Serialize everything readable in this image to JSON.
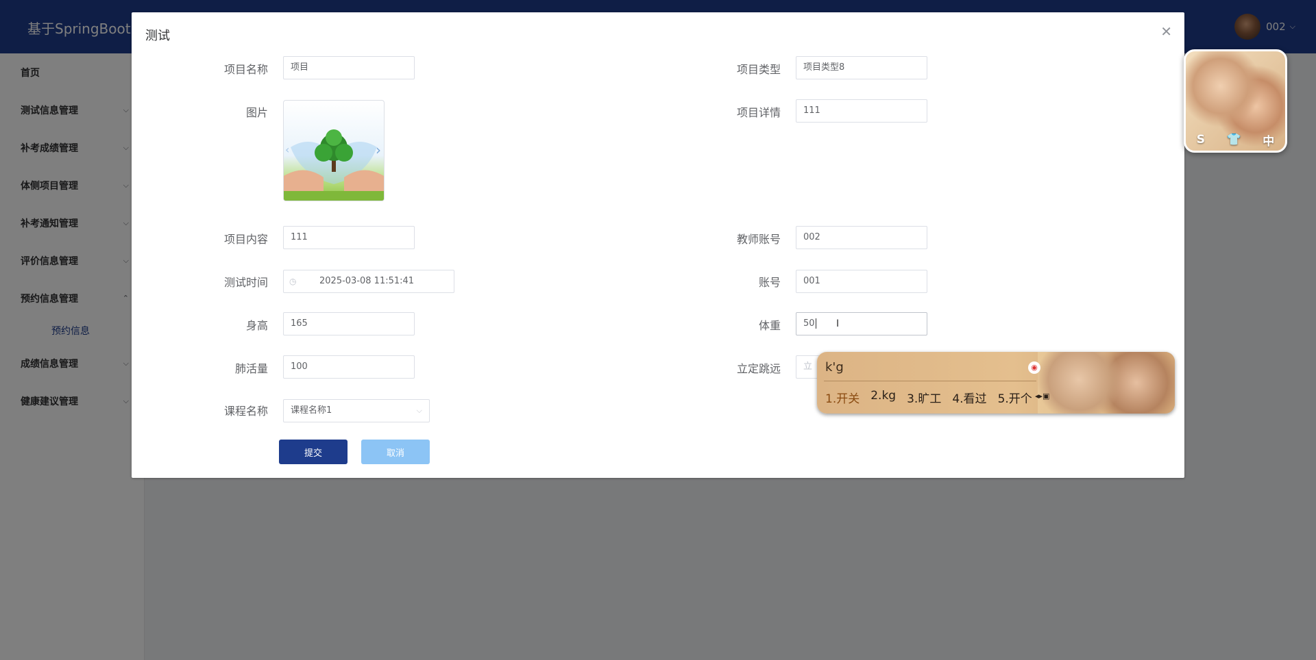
{
  "app": {
    "title": "基于SpringBoot",
    "user": "002"
  },
  "sidebar": {
    "items": [
      {
        "label": "首页"
      },
      {
        "label": "测试信息管理"
      },
      {
        "label": "补考成绩管理"
      },
      {
        "label": "体侧项目管理"
      },
      {
        "label": "补考通知管理"
      },
      {
        "label": "评价信息管理"
      },
      {
        "label": "预约信息管理"
      },
      {
        "label": "预约信息"
      },
      {
        "label": "成绩信息管理"
      },
      {
        "label": "健康建议管理"
      }
    ]
  },
  "dialog": {
    "title": "测试",
    "fields": {
      "project_name": {
        "label": "项目名称",
        "value": "项目"
      },
      "project_type": {
        "label": "项目类型",
        "value": "项目类型8"
      },
      "image": {
        "label": "图片"
      },
      "project_detail": {
        "label": "项目详情",
        "value": "111"
      },
      "project_content": {
        "label": "项目内容",
        "value": "111"
      },
      "teacher_account": {
        "label": "教师账号",
        "value": "002"
      },
      "test_time": {
        "label": "测试时间",
        "value": "2025-03-08 11:51:41"
      },
      "account": {
        "label": "账号",
        "value": "001"
      },
      "height": {
        "label": "身高",
        "value": "165"
      },
      "weight": {
        "label": "体重",
        "value": "50"
      },
      "lung_capacity": {
        "label": "肺活量",
        "value": "100"
      },
      "long_jump": {
        "label": "立定跳远",
        "placeholder": "立"
      },
      "course_name": {
        "label": "课程名称",
        "value": "课程名称1"
      }
    },
    "buttons": {
      "submit": "提交",
      "cancel": "取消"
    }
  },
  "ime": {
    "input": "k'g",
    "candidates": [
      "1.开关",
      "2.kg",
      "3.旷工",
      "4.看过",
      "5.开个"
    ]
  },
  "skin_widget": {
    "icons": [
      "S",
      "👕",
      "中"
    ]
  },
  "colors": {
    "primary": "#1e3c8c",
    "cancel": "#8cc4f5",
    "overlay": "rgba(0,0,0,0.5)"
  }
}
